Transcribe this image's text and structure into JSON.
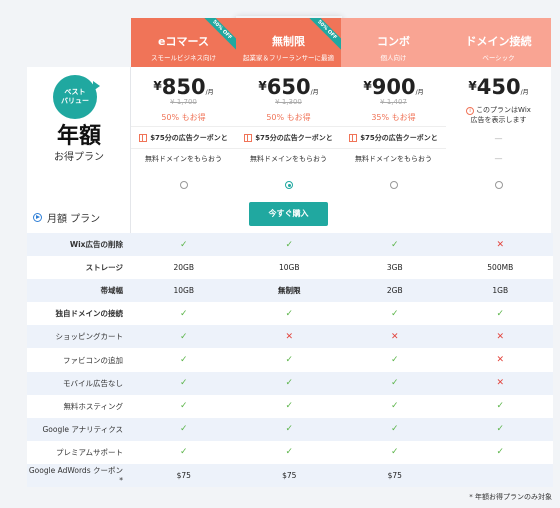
{
  "left": {
    "badge_line1": "ベスト",
    "badge_line2": "バリュー",
    "title": "年額",
    "subtitle": "お得プラン",
    "monthly_label": "月額 プラン"
  },
  "colors": {
    "head_a": "#f07458",
    "head_b": "#f9a493",
    "teal": "#20a8a0",
    "check": "#5ab448",
    "cross": "#e2443c"
  },
  "plans": [
    {
      "name": "eコマース",
      "sub": "スモールビジネス向け",
      "ribbon": "50% OFF",
      "yen": "¥",
      "price": "850",
      "per": "/月",
      "old": "¥ 1,700",
      "save": "50% もお得",
      "coupon": "$75分の広告クーポンと",
      "free": "無料ドメインをもらおう",
      "selected": false
    },
    {
      "name": "無制限",
      "sub": "起業家＆フリーランサーに最適",
      "ribbon": "50% OFF",
      "yen": "¥",
      "price": "650",
      "per": "/月",
      "old": "¥ 1,300",
      "save": "50% もお得",
      "coupon": "$75分の広告クーポンと",
      "free": "無料ドメインをもらおう",
      "selected": true,
      "buy": "今すぐ購入"
    },
    {
      "name": "コンボ",
      "sub": "個人向け",
      "yen": "¥",
      "price": "900",
      "per": "/月",
      "old": "¥ 1,407",
      "save": "35% もお得",
      "coupon": "$75分の広告クーポンと",
      "free": "無料ドメインをもらおう",
      "selected": false
    },
    {
      "name": "ドメイン接続",
      "sub": "ベーシック",
      "yen": "¥",
      "price": "450",
      "per": "/月",
      "warn1": "このプランはWix",
      "warn2": "広告を表示します",
      "dash1": "—",
      "dash2": "—",
      "selected": false
    }
  ],
  "features": [
    {
      "label": "Wix広告の削除",
      "bold": true,
      "vals": [
        "check",
        "check",
        "check",
        "cross"
      ]
    },
    {
      "label": "ストレージ",
      "bold": true,
      "vals": [
        "20GB",
        "10GB",
        "3GB",
        "500MB"
      ]
    },
    {
      "label": "帯域幅",
      "bold": true,
      "vals": [
        "10GB",
        "無制限",
        "2GB",
        "1GB"
      ],
      "boldIdx": 1
    },
    {
      "label": "独自ドメインの接続",
      "bold": true,
      "vals": [
        "check",
        "check",
        "check",
        "check"
      ]
    },
    {
      "label": "ショッピングカート",
      "bold": false,
      "vals": [
        "check",
        "cross",
        "cross",
        "cross"
      ]
    },
    {
      "label": "ファビコンの追加",
      "bold": false,
      "vals": [
        "check",
        "check",
        "check",
        "cross"
      ]
    },
    {
      "label": "モバイル広告なし",
      "bold": false,
      "vals": [
        "check",
        "check",
        "check",
        "cross"
      ]
    },
    {
      "label": "無料ホスティング",
      "bold": false,
      "vals": [
        "check",
        "check",
        "check",
        "check"
      ]
    },
    {
      "label": "Google アナリティクス",
      "bold": false,
      "vals": [
        "check",
        "check",
        "check",
        "check"
      ]
    },
    {
      "label": "プレミアムサポート",
      "bold": false,
      "vals": [
        "check",
        "check",
        "check",
        "check"
      ]
    },
    {
      "label": "Google AdWords クーポン*",
      "bold": false,
      "vals": [
        "$75",
        "$75",
        "$75",
        "—"
      ]
    }
  ],
  "footnote": "* 年額お得プランのみ対象"
}
